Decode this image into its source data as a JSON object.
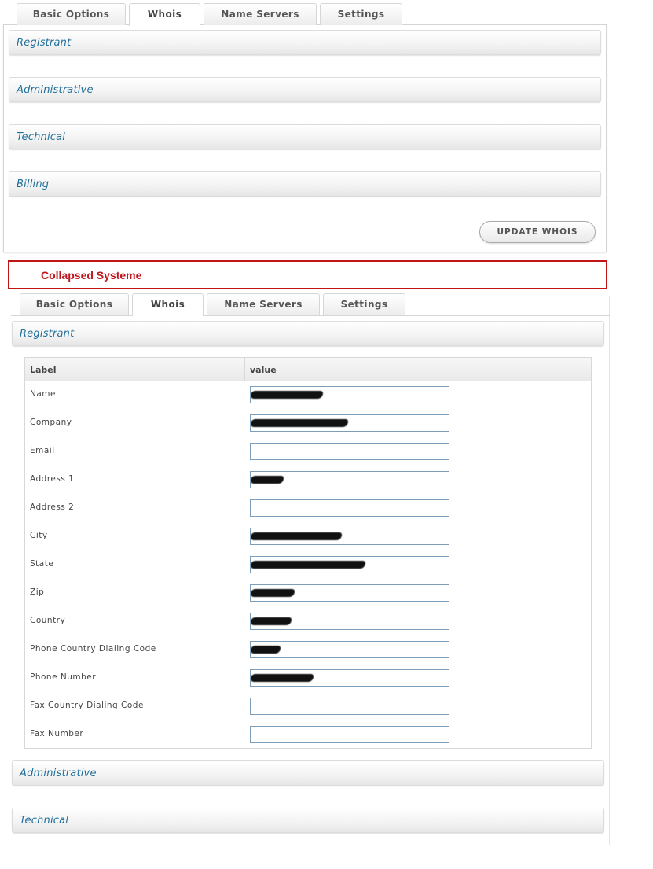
{
  "tabs_top": [
    "Basic Options",
    "Whois",
    "Name Servers",
    "Settings"
  ],
  "tabs_bottom": [
    "Basic Options",
    "Whois",
    "Name Servers",
    "Settings"
  ],
  "top_sections": [
    "Registrant",
    "Administrative",
    "Technical",
    "Billing"
  ],
  "update_button": "UPDATE WHOIS",
  "collapsed_label": "Collapsed Systeme",
  "bottom_sections": [
    "Registrant",
    "Administrative",
    "Technical"
  ],
  "table": {
    "headers": [
      "Label",
      "value"
    ],
    "rows": [
      {
        "label": "Name",
        "value": ""
      },
      {
        "label": "Company",
        "value": ""
      },
      {
        "label": "Email",
        "value": ""
      },
      {
        "label": "Address 1",
        "value": ""
      },
      {
        "label": "Address 2",
        "value": ""
      },
      {
        "label": "City",
        "value": ""
      },
      {
        "label": "State",
        "value": ""
      },
      {
        "label": "Zip",
        "value": ""
      },
      {
        "label": "Country",
        "value": ""
      },
      {
        "label": "Phone Country Dialing Code",
        "value": ""
      },
      {
        "label": "Phone Number",
        "value": ""
      },
      {
        "label": "Fax Country Dialing Code",
        "value": ""
      },
      {
        "label": "Fax Number",
        "value": ""
      }
    ],
    "redacted": [
      true,
      true,
      false,
      true,
      false,
      true,
      true,
      true,
      true,
      true,
      true,
      false,
      false
    ]
  },
  "colors": {
    "section_title": "#1f6f9a",
    "alert_border": "#c21616",
    "alert_text": "#c0151d"
  }
}
